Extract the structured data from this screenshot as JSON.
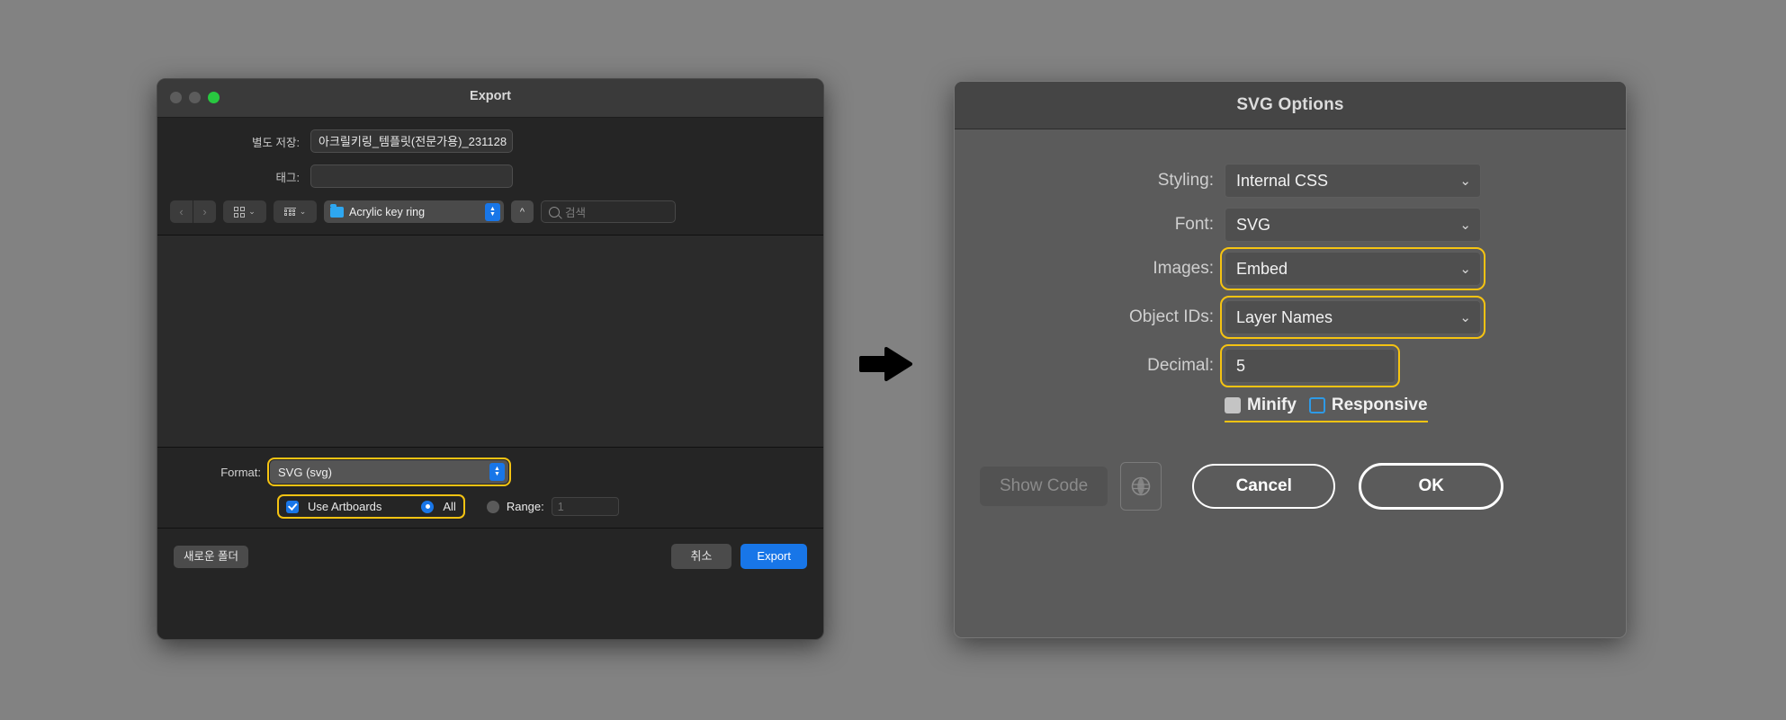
{
  "canvas": {
    "background": "#828282"
  },
  "export_dialog": {
    "title": "Export",
    "save_as": {
      "label": "별도 저장:",
      "value": "아크릴키링_템플릿(전문가용)_231128"
    },
    "tags": {
      "label": "태그:",
      "value": "",
      "placeholder": ""
    },
    "toolbar": {
      "back_icon": "‹",
      "forward_icon": "›",
      "icon_view_chevron": "⌄",
      "list_view_chevron": "⌄",
      "location": "Acrylic key ring",
      "stepper_up": "▲",
      "stepper_down": "▼",
      "up_button": "^",
      "search_placeholder": "검색"
    },
    "format": {
      "label": "Format:",
      "value": "SVG (svg)"
    },
    "use_artboards": {
      "label": "Use Artboards",
      "checked": true
    },
    "all_radio": {
      "label": "All",
      "selected": true
    },
    "range_radio": {
      "label": "Range:",
      "selected": false,
      "value": "1"
    },
    "footer": {
      "new_folder": "새로운 폴더",
      "cancel": "취소",
      "export": "Export"
    },
    "accent_highlight": "#f5c312",
    "accent_blue": "#1876e8"
  },
  "arrow": {
    "name": "right-arrow",
    "color": "#000000"
  },
  "svg_options_dialog": {
    "title": "SVG Options",
    "rows": [
      {
        "label": "Styling:",
        "value": "Internal CSS",
        "type": "select",
        "highlighted": false
      },
      {
        "label": "Font:",
        "value": "SVG",
        "type": "select",
        "highlighted": false
      },
      {
        "label": "Images:",
        "value": "Embed",
        "type": "select",
        "highlighted": true
      },
      {
        "label": "Object IDs:",
        "value": "Layer Names",
        "type": "select",
        "highlighted": true
      },
      {
        "label": "Decimal:",
        "value": "5",
        "type": "input",
        "highlighted": true
      }
    ],
    "checkboxes": [
      {
        "label": "Minify",
        "state": "filled"
      },
      {
        "label": "Responsive",
        "state": "outline"
      }
    ],
    "footer": {
      "show_code": "Show Code",
      "preview_icon": "globe-icon",
      "cancel": "Cancel",
      "ok": "OK"
    },
    "accent_highlight": "#f5c312",
    "accent_blue": "#2e9ae6"
  }
}
